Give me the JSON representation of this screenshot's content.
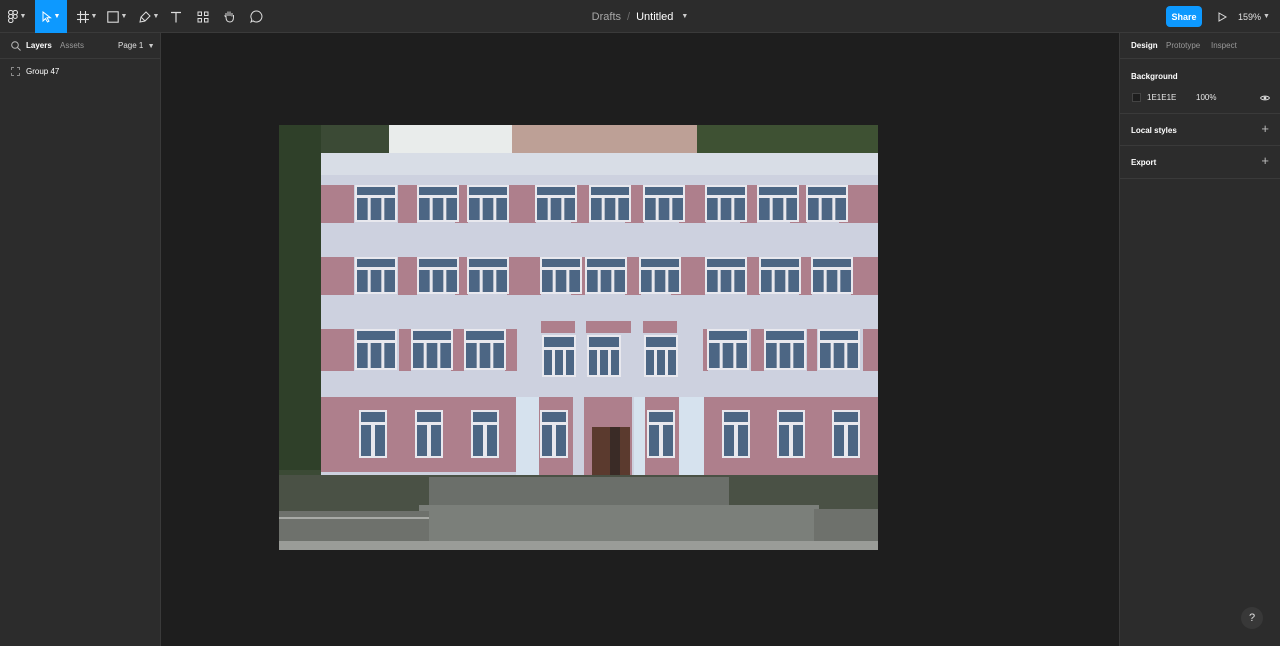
{
  "toolbar": {
    "breadcrumb_drafts": "Drafts",
    "breadcrumb_separator": "/",
    "file_title": "Untitled",
    "share_label": "Share",
    "zoom_level": "159%",
    "tools": [
      "main-menu",
      "move",
      "frame",
      "shape",
      "pen",
      "text",
      "resources",
      "hand",
      "comment"
    ],
    "accent_color": "#0d99ff"
  },
  "left_panel": {
    "tabs": [
      "Layers",
      "Assets"
    ],
    "page_selector": "Page 1",
    "layers": [
      {
        "name": "Group 47"
      }
    ]
  },
  "right_panel": {
    "tabs": [
      "Design",
      "Prototype",
      "Inspect"
    ],
    "background": {
      "title": "Background",
      "color_hex": "1E1E1E",
      "opacity": "100%"
    },
    "local_styles_title": "Local styles",
    "export_title": "Export"
  },
  "help_label": "?",
  "canvas": {
    "background_color": "#1e1e1e",
    "facade_pink": "#ae7f8c",
    "facade_grey": "#cdd1df",
    "window_blue": "#4c6684"
  }
}
